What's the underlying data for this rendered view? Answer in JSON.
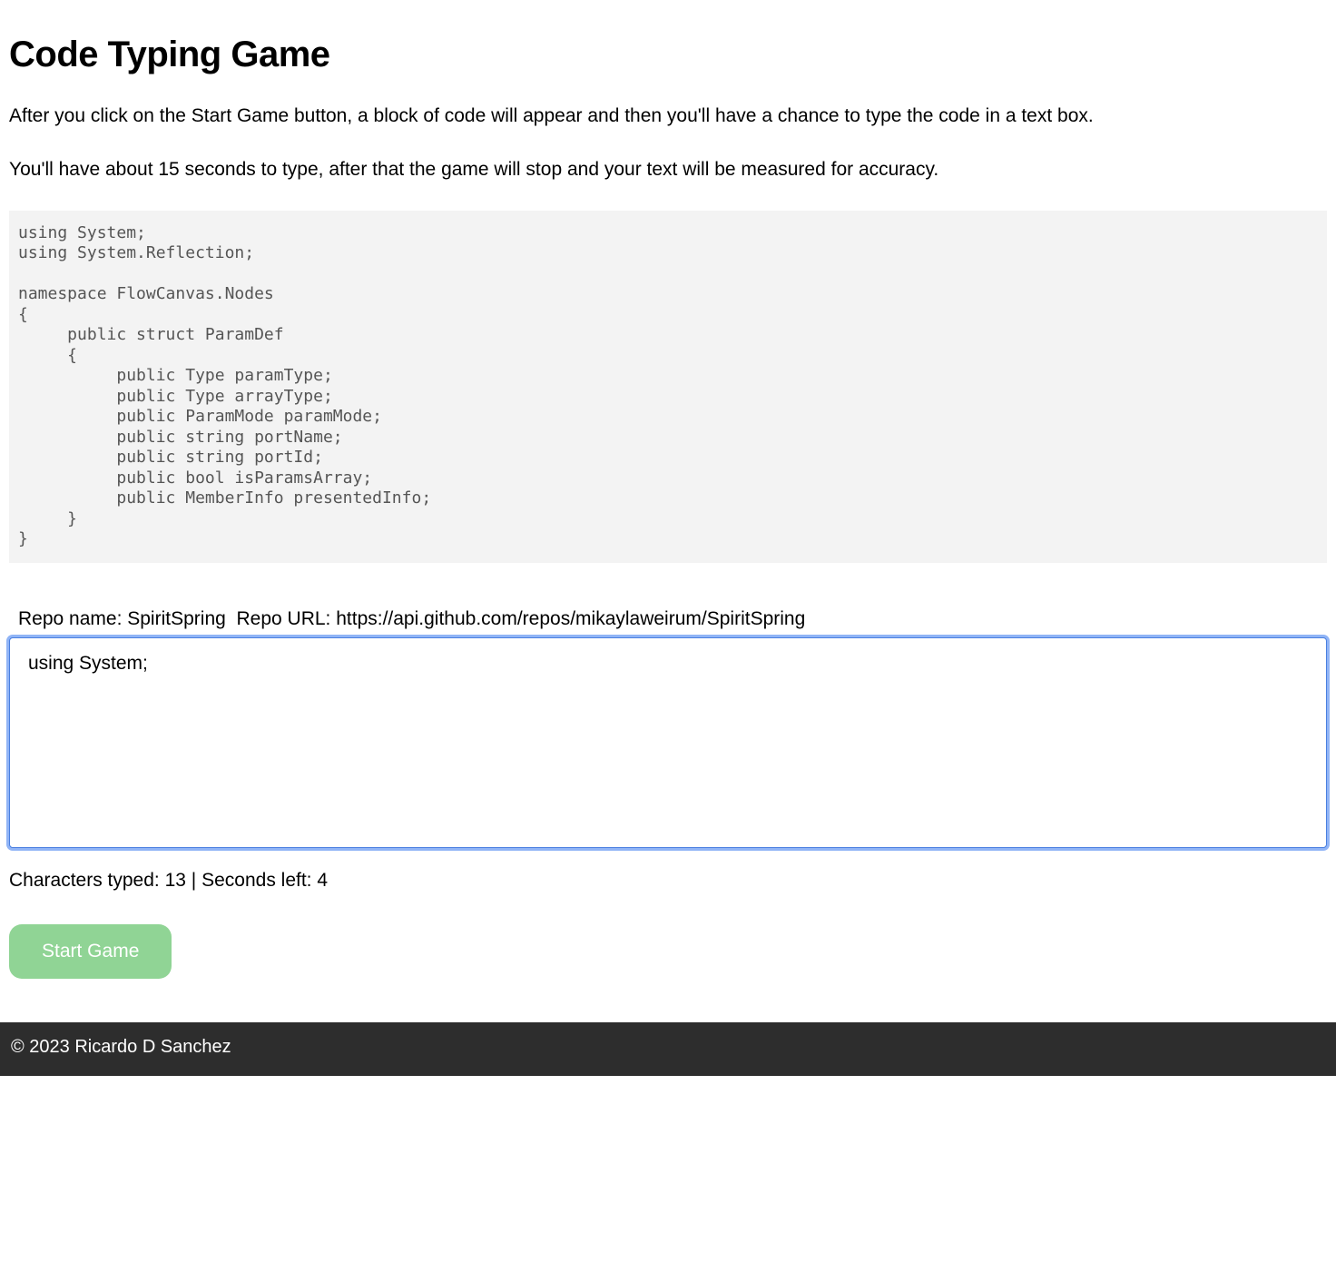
{
  "header": {
    "title": "Code Typing Game"
  },
  "instructions": {
    "line1": "After you click on the Start Game button, a block of code will appear and then you'll have a chance to type the code in a text box.",
    "line2": "You'll have about 15 seconds to type, after that the game will stop and your text will be measured for accuracy."
  },
  "code_block": "using System;\nusing System.Reflection;\n\nnamespace FlowCanvas.Nodes\n{\n     public struct ParamDef\n     {\n          public Type paramType;\n          public Type arrayType;\n          public ParamMode paramMode;\n          public string portName;\n          public string portId;\n          public bool isParamsArray;\n          public MemberInfo presentedInfo;\n     }\n}",
  "repo": {
    "name_label": "Repo name:",
    "name_value": "SpiritSpring",
    "url_label": "Repo URL:",
    "url_value": "https://api.github.com/repos/mikaylaweirum/SpiritSpring"
  },
  "input": {
    "value": "using System;"
  },
  "status": {
    "chars_label": "Characters typed:",
    "chars_value": "13",
    "separator": "|",
    "seconds_label": "Seconds left:",
    "seconds_value": "4"
  },
  "buttons": {
    "start": "Start Game"
  },
  "footer": {
    "copyright": "© 2023 Ricardo D Sanchez"
  }
}
